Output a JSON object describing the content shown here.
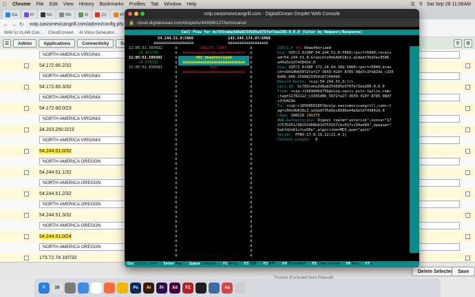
{
  "menubar": {
    "items": [
      "Chrome",
      "File",
      "Edit",
      "View",
      "History",
      "Bookmarks",
      "Profiles",
      "Tab",
      "Window",
      "Help"
    ],
    "clock": "Sat Sep 28  11:08AM"
  },
  "tabs": [
    {
      "label": "Ga",
      "color": "#2b7de9"
    },
    {
      "label": "M",
      "color": "#7a4bd6"
    },
    {
      "label": "No",
      "color": "#333333"
    },
    {
      "label": "We",
      "color": "#888888"
    },
    {
      "label": "AI",
      "color": "#5c9a5c"
    },
    {
      "label": "(1)",
      "color": "#d9342b"
    },
    {
      "label": "40",
      "color": "#e08b1c"
    }
  ],
  "address": {
    "url": "voip.oasismexicangrill.com/admin/config.php"
  },
  "bookmarks": [
    "WAV to ULAW Con...",
    "CloudConvert",
    "AI Voice Generator..."
  ],
  "app_toolbar": {
    "buttons": [
      "Admin",
      "Applications",
      "Connectivity",
      "Dashbo"
    ]
  },
  "ip_rows": [
    {
      "type": "select",
      "value": "NORTH AMERICA VIRGINIA"
    },
    {
      "type": "ip",
      "value": "54.172.60.2/32",
      "highlight": false
    },
    {
      "type": "select",
      "value": "NORTH AMERICA VIRGINIA"
    },
    {
      "type": "ip",
      "value": "54.172.60.3/32",
      "highlight": false
    },
    {
      "type": "select",
      "value": "NORTH AMERICA VIRGINIA"
    },
    {
      "type": "ip",
      "value": "54.172.60.0/23",
      "highlight": false
    },
    {
      "type": "select",
      "value": "NORTH AMERICA VIRGINIA"
    },
    {
      "type": "ip",
      "value": "34.203.250.0/23",
      "highlight": false
    },
    {
      "type": "select",
      "value": "NORTH AMERICA VIRGINIA"
    },
    {
      "type": "ip",
      "value": "54.244.51.0/32",
      "highlight": true
    },
    {
      "type": "select",
      "value": "NORTH AMERICA OREGON"
    },
    {
      "type": "ip",
      "value": "54.244.51.1/32",
      "highlight": false
    },
    {
      "type": "select",
      "value": "NORTH AMERICA OREGON"
    },
    {
      "type": "ip",
      "value": "54.244.51.2/32",
      "highlight": false
    },
    {
      "type": "select",
      "value": "NORTH AMERICA OREGON"
    },
    {
      "type": "ip",
      "value": "54.244.51.3/32",
      "highlight": false
    },
    {
      "type": "select",
      "value": "NORTH AMERICA OREGON"
    },
    {
      "type": "ip",
      "value": "54.244.51.0/24",
      "highlight": true
    },
    {
      "type": "select",
      "value": "NORTH AMERICA OREGON"
    },
    {
      "type": "ip",
      "value": "173.72.74.187/32",
      "highlight": false
    }
  ],
  "bottom": {
    "delete_label": "Delete Selected",
    "save_label": "Save",
    "note": "Trusted (Excluded from Firewall)"
  },
  "console": {
    "window_title": "voip.oasismexicangrill.com - DigitalOcean Droplet Web Console",
    "url": "cloud.digitalocean.com/droplets/443586137/terminal/ui/",
    "header": "Call flow for bc783ceba3d8a8254585e9707ef2ee280.0.0.0 (Color by Request/Response)",
    "left_addr": "54.244.51.0:5060",
    "right_addr": "143.244.174.97:5060",
    "left_stars": "ääääääääääääääääää",
    "right_stars": "ääääääääääääääääää",
    "timestamps": [
      {
        "time": "11:05:51.587632",
        "style": "normal"
      },
      {
        "time": "+0.001760",
        "style": "delta"
      },
      {
        "time": "11:05:51.589392",
        "style": "bold"
      },
      {
        "time": "+0.070191",
        "style": "delta"
      },
      {
        "time": "11:05:51.659583",
        "style": "normal"
      }
    ],
    "messages": [
      {
        "text": "INVITE (SDP)",
        "style": "red"
      },
      {
        "text": "ääääääääääääääääääääääääääää",
        "style": "red"
      },
      {
        "text": "401 Unauthorized",
        "style": "sel"
      },
      {
        "text": "ääääääääääääääääääääääääääää",
        "style": "sel"
      },
      {
        "text": "ACK",
        "style": "red"
      },
      {
        "text": "ääääääääääääääääääääääääääää",
        "style": "red"
      }
    ],
    "sip_lines": [
      {
        "k": "SIP/2.0 ",
        "v": "",
        "red": "401",
        "rest": " Unauthorized"
      },
      {
        "k": "Via: ",
        "v": "SIP/2.0/UDP 54.244.51.0:5060;rport=5060;receiv"
      },
      {
        "k": "",
        "v": "ed=54.244.51.0;branch=z9hG4bK18c2.a2dadf35d5ec8586"
      },
      {
        "k": "",
        "v": "a44a5e1d743842d.0"
      },
      {
        "k": "Via: ",
        "v": "SIP/2.0/UDP 172.18.64.189:5060;rport=5060;bran"
      },
      {
        "k": "",
        "v": "ch=z9hG4bK5072faf27-3659-410f-8785-98d7c3fb829e_c335"
      },
      {
        "k": "",
        "v": "6d0b_606-259081595418710449O"
      },
      {
        "k": "Record-Route: ",
        "v": "<sip:54.244.51.0;lr>"
      },
      {
        "k": "Call-ID: ",
        "v": "bc783ceba3d8a8254585e9707ef2ee280.0.0.0"
      },
      {
        "k": "From: ",
        "v": "<sip:+16098464756@voip-oasis.pstn.twilio.com>"
      },
      {
        "k": "",
        "v": ";tag=12782122_c3356d0b_5072fa27-3659-410f-8785-98d7"
      },
      {
        "k": "",
        "v": "c3fb829e"
      },
      {
        "k": "To: ",
        "v": "<sip:+18568581807@voip.oasismexicangrill.com>;t"
      },
      {
        "k": "",
        "v": "ag=z9hG4bK18c2.a2dadf35d5ec8586a44a5e1d743842d.0"
      },
      {
        "k": "CSeq: ",
        "v": "348228 ",
        "yel": "INVITE"
      },
      {
        "k": "WWW-Authenticate: ",
        "v": "Digest realm=\"asterisk\",nonce=\"17"
      },
      {
        "k": "",
        "v": "27535951/98252d88b81d759167cbc01fcc94ad69\",opaque=\""
      },
      {
        "k": "",
        "v": "5abfd2e61cfce50e\",algorithm=MD5,qop=\"auth\""
      },
      {
        "k": "Server: ",
        "v": "FPBX-17.0.19.12(21.4.1)"
      },
      {
        "k": "Content-Length: ",
        "v": " 0"
      }
    ],
    "footer": [
      {
        "key": "Esc",
        "label": "Calls List"
      },
      {
        "key": "Enter",
        "label": "Raw"
      },
      {
        "key": "Space",
        "label": "Compare"
      },
      {
        "key": "F1",
        "label": "Help"
      },
      {
        "key": "F2",
        "label": "SDP"
      },
      {
        "key": "F3",
        "label": "RTP"
      },
      {
        "key": "F4",
        "label": "Extended"
      },
      {
        "key": "F5",
        "label": "Compressed"
      },
      {
        "key": "F6",
        "label": "Raw"
      },
      {
        "key": "F7",
        "label": "c"
      }
    ]
  },
  "dock_apps": [
    {
      "label": "F",
      "color": "#2f7de1"
    },
    {
      "label": "28",
      "color": "#e0e0e0"
    },
    {
      "label": "",
      "color": "#7a7a7a"
    },
    {
      "label": "",
      "color": "#3c8ee5"
    },
    {
      "label": "",
      "color": "#ffffff"
    },
    {
      "label": "",
      "color": "#ff6b3d"
    },
    {
      "label": "",
      "color": "#f4b400"
    },
    {
      "label": "Ps",
      "color": "#0b2a54"
    },
    {
      "label": "Ai",
      "color": "#3a1a00"
    },
    {
      "label": "Pr",
      "color": "#2a0f4a"
    },
    {
      "label": "Xd",
      "color": "#470137"
    },
    {
      "label": "FZ",
      "color": "#b22222"
    },
    {
      "label": "",
      "color": "#1e1e1e"
    },
    {
      "label": "",
      "color": "#3a6ea5"
    },
    {
      "label": "Aa",
      "color": "#d64545"
    },
    {
      "label": "",
      "color": "#cfcfcf"
    }
  ]
}
